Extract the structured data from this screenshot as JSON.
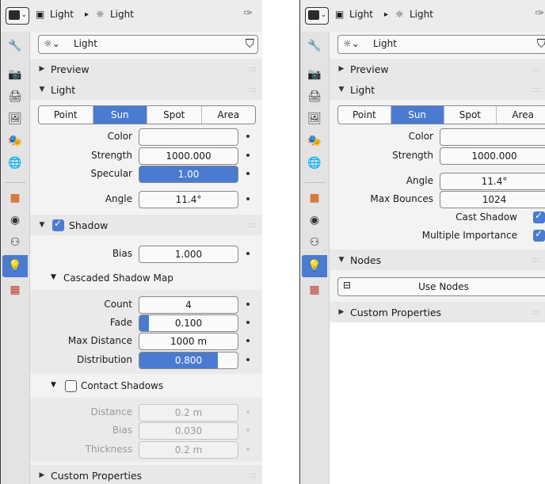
{
  "header": {
    "crumb_1": "Light",
    "separator": "▸",
    "crumb_2": "Light",
    "datablock_name": "Light"
  },
  "sections": {
    "preview": "Preview",
    "light": "Light",
    "shadow": "Shadow",
    "cascaded": "Cascaded Shadow Map",
    "contact": "Contact Shadows",
    "nodes": "Nodes",
    "custom": "Custom Properties"
  },
  "light_types": [
    "Point",
    "Sun",
    "Spot",
    "Area"
  ],
  "selected_light_type": "Sun",
  "left": {
    "props": [
      {
        "label": "Color",
        "value": ""
      },
      {
        "label": "Strength",
        "value": "1000.000"
      },
      {
        "label": "Specular",
        "value": "1.00",
        "fill": 1.0
      },
      {
        "label": "Angle",
        "value": "11.4°"
      }
    ],
    "shadow_enabled": true,
    "bias_label": "Bias",
    "bias_value": "1.000",
    "csm": [
      {
        "label": "Count",
        "value": "4"
      },
      {
        "label": "Fade",
        "value": "0.100",
        "fill": 0.1
      },
      {
        "label": "Max Distance",
        "value": "1000 m"
      },
      {
        "label": "Distribution",
        "value": "0.800",
        "fill": 0.8
      }
    ],
    "contact_enabled": false,
    "contact": [
      {
        "label": "Distance",
        "value": "0.2 m"
      },
      {
        "label": "Bias",
        "value": "0.030"
      },
      {
        "label": "Thickness",
        "value": "0.2 m"
      }
    ]
  },
  "right": {
    "props": [
      {
        "label": "Color",
        "value": ""
      },
      {
        "label": "Strength",
        "value": "1000.000"
      },
      {
        "label": "Angle",
        "value": "11.4°"
      },
      {
        "label": "Max Bounces",
        "value": "1024"
      }
    ],
    "cast_shadow": "Cast Shadow",
    "multiple_importance": "Multiple Importance",
    "use_nodes": "Use Nodes"
  },
  "colors": {
    "accent": "#4a7bd0"
  }
}
